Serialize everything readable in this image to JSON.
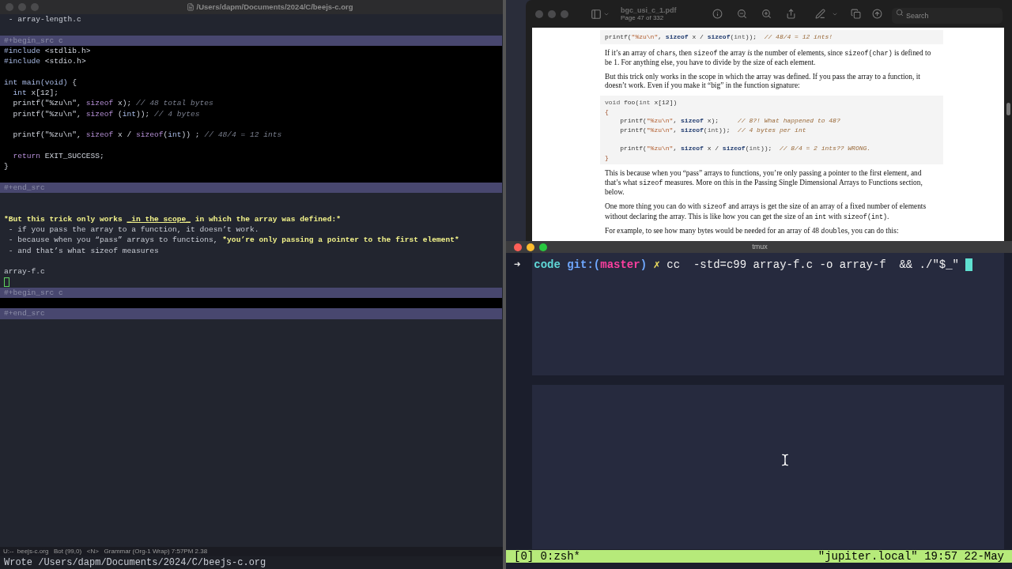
{
  "editor": {
    "title": "/Users/dapm/Documents/2024/C/beejs-c.org",
    "lines": [
      {
        "kind": "text",
        "segments": [
          {
            "kind": "plain",
            "text": " - array-length.c"
          }
        ]
      },
      {
        "kind": "blank"
      },
      {
        "kind": "block",
        "text": "#+begin_src c"
      },
      {
        "kind": "code",
        "tokens": [
          {
            "kind": "preproc",
            "text": "#include"
          },
          {
            "kind": "plain",
            "text": " <stdlib.h>"
          }
        ]
      },
      {
        "kind": "code",
        "tokens": [
          {
            "kind": "preproc",
            "text": "#include"
          },
          {
            "kind": "plain",
            "text": " <stdio.h>"
          }
        ]
      },
      {
        "kind": "code_blank"
      },
      {
        "kind": "code",
        "tokens": [
          {
            "kind": "type",
            "text": "int main(void)"
          },
          {
            "kind": "plain",
            "text": " {"
          }
        ]
      },
      {
        "kind": "code",
        "tokens": [
          {
            "kind": "type",
            "text": "  int"
          },
          {
            "kind": "plain",
            "text": " x[12];"
          }
        ]
      },
      {
        "kind": "code",
        "tokens": [
          {
            "kind": "plain",
            "text": "  printf(\"%zu\\n\", "
          },
          {
            "kind": "keyword",
            "text": "sizeof"
          },
          {
            "kind": "plain",
            "text": " x); "
          },
          {
            "kind": "comment",
            "text": "// 48 total bytes"
          }
        ]
      },
      {
        "kind": "code",
        "tokens": [
          {
            "kind": "plain",
            "text": "  printf(\"%zu\\n\", "
          },
          {
            "kind": "keyword",
            "text": "sizeof"
          },
          {
            "kind": "plain",
            "text": " ("
          },
          {
            "kind": "type",
            "text": "int"
          },
          {
            "kind": "plain",
            "text": ")); "
          },
          {
            "kind": "comment",
            "text": "// 4 bytes"
          }
        ]
      },
      {
        "kind": "code_blank"
      },
      {
        "kind": "code",
        "tokens": [
          {
            "kind": "plain",
            "text": "  printf(\"%zu\\n\", "
          },
          {
            "kind": "keyword",
            "text": "sizeof"
          },
          {
            "kind": "plain",
            "text": " x / "
          },
          {
            "kind": "keyword",
            "text": "sizeof"
          },
          {
            "kind": "plain",
            "text": "("
          },
          {
            "kind": "type",
            "text": "int"
          },
          {
            "kind": "plain",
            "text": ")) ; "
          },
          {
            "kind": "comment",
            "text": "// 48/4 = 12 ints"
          }
        ]
      },
      {
        "kind": "code_blank"
      },
      {
        "kind": "code",
        "tokens": [
          {
            "kind": "keyword",
            "text": "  return"
          },
          {
            "kind": "plain",
            "text": " EXIT_SUCCESS;"
          }
        ]
      },
      {
        "kind": "code",
        "tokens": [
          {
            "kind": "plain",
            "text": "}"
          }
        ]
      },
      {
        "kind": "code_blank"
      },
      {
        "kind": "block",
        "text": "#+end_src"
      },
      {
        "kind": "blank"
      },
      {
        "kind": "blank"
      },
      {
        "kind": "text",
        "segments": [
          {
            "kind": "bold",
            "text": "*But this trick only works "
          },
          {
            "kind": "bold_underline",
            "text": "_in the scope_"
          },
          {
            "kind": "bold",
            "text": " in which the array was defined:*"
          }
        ]
      },
      {
        "kind": "text",
        "segments": [
          {
            "kind": "plain",
            "text": " - if you pass the array to a function, it doesn’t work."
          }
        ]
      },
      {
        "kind": "text",
        "segments": [
          {
            "kind": "plain",
            "text": " - because when you “pass” arrays to functions, "
          },
          {
            "kind": "bold",
            "text": "*you’re only passing a pointer to the first element*"
          }
        ]
      },
      {
        "kind": "text",
        "segments": [
          {
            "kind": "plain",
            "text": " - and that’s what sizeof measures"
          }
        ]
      },
      {
        "kind": "blank"
      },
      {
        "kind": "text",
        "segments": [
          {
            "kind": "plain",
            "text": "array-f.c"
          }
        ]
      },
      {
        "kind": "cursor"
      },
      {
        "kind": "block",
        "text": "#+begin_src c"
      },
      {
        "kind": "code_blank"
      },
      {
        "kind": "block",
        "text": "#+end_src"
      }
    ],
    "modeline": "U:--  beejs-c.org   Bot (99,0)   <N>   Grammar (Org-1 Wrap) 7:57PM 2.38",
    "echo": "Wrote /Users/dapm/Documents/2024/C/beejs-c.org"
  },
  "pdf": {
    "file": "bgc_usi_c_1.pdf",
    "page": "Page 47 of 332",
    "search_placeholder": "Search",
    "blocks": [
      {
        "kind": "code",
        "lines": [
          {
            "kind": "tokens",
            "tokens": [
              {
                "kind": "plain",
                "text": "printf("
              },
              {
                "kind": "string",
                "text": "\"%zu\\n\""
              },
              {
                "kind": "plain",
                "text": ", "
              },
              {
                "kind": "keyword",
                "text": "sizeof"
              },
              {
                "kind": "plain",
                "text": " x / "
              },
              {
                "kind": "keyword",
                "text": "sizeof"
              },
              {
                "kind": "plain",
                "text": "("
              },
              {
                "kind": "type",
                "text": "int"
              },
              {
                "kind": "plain",
                "text": "));  "
              },
              {
                "kind": "comment",
                "text": "// 48/4 = 12 ints!"
              }
            ]
          }
        ]
      },
      {
        "kind": "para",
        "segments": [
          {
            "kind": "text",
            "text": "If it’s an array of "
          },
          {
            "kind": "code",
            "text": "char"
          },
          {
            "kind": "text",
            "text": "s, then "
          },
          {
            "kind": "code",
            "text": "sizeof"
          },
          {
            "kind": "text",
            "text": " the array "
          },
          {
            "kind": "italic",
            "text": "is"
          },
          {
            "kind": "text",
            "text": " the number of elements, since "
          },
          {
            "kind": "code",
            "text": "sizeof(char)"
          },
          {
            "kind": "text",
            "text": " is defined to be 1. For anything else, you have to divide by the size of each element."
          }
        ]
      },
      {
        "kind": "para",
        "segments": [
          {
            "kind": "text",
            "text": "But this trick only works in the scope in which the array was defined. If you pass the array to a function, it doesn’t work. Even if you make it “big” in the function signature:"
          }
        ]
      },
      {
        "kind": "code",
        "lines": [
          {
            "kind": "tokens",
            "tokens": [
              {
                "kind": "type",
                "text": "void"
              },
              {
                "kind": "plain",
                "text": " foo("
              },
              {
                "kind": "type",
                "text": "int"
              },
              {
                "kind": "plain",
                "text": " x[12])"
              }
            ]
          },
          {
            "kind": "tokens",
            "tokens": [
              {
                "kind": "punct",
                "text": "{"
              }
            ]
          },
          {
            "kind": "tokens",
            "tokens": [
              {
                "kind": "plain",
                "text": "    printf("
              },
              {
                "kind": "string",
                "text": "\"%zu\\n\""
              },
              {
                "kind": "plain",
                "text": ", "
              },
              {
                "kind": "keyword",
                "text": "sizeof"
              },
              {
                "kind": "plain",
                "text": " x);     "
              },
              {
                "kind": "comment",
                "text": "// 8?! What happened to 48?"
              }
            ]
          },
          {
            "kind": "tokens",
            "tokens": [
              {
                "kind": "plain",
                "text": "    printf("
              },
              {
                "kind": "string",
                "text": "\"%zu\\n\""
              },
              {
                "kind": "plain",
                "text": ", "
              },
              {
                "kind": "keyword",
                "text": "sizeof"
              },
              {
                "kind": "plain",
                "text": "("
              },
              {
                "kind": "type",
                "text": "int"
              },
              {
                "kind": "plain",
                "text": "));  "
              },
              {
                "kind": "comment",
                "text": "// 4 bytes per int"
              }
            ]
          },
          {
            "kind": "blank"
          },
          {
            "kind": "tokens",
            "tokens": [
              {
                "kind": "plain",
                "text": "    printf("
              },
              {
                "kind": "string",
                "text": "\"%zu\\n\""
              },
              {
                "kind": "plain",
                "text": ", "
              },
              {
                "kind": "keyword",
                "text": "sizeof"
              },
              {
                "kind": "plain",
                "text": " x / "
              },
              {
                "kind": "keyword",
                "text": "sizeof"
              },
              {
                "kind": "plain",
                "text": "("
              },
              {
                "kind": "type",
                "text": "int"
              },
              {
                "kind": "plain",
                "text": "));  "
              },
              {
                "kind": "comment",
                "text": "// 8/4 = 2 ints?? WRONG."
              }
            ]
          },
          {
            "kind": "tokens",
            "tokens": [
              {
                "kind": "punct",
                "text": "}"
              }
            ]
          }
        ]
      },
      {
        "kind": "para",
        "segments": [
          {
            "kind": "text",
            "text": "This is because when you “pass” arrays to functions, you’re only passing a pointer to the first element, and that’s what "
          },
          {
            "kind": "code",
            "text": "sizeof"
          },
          {
            "kind": "text",
            "text": " measures. More on this in the Passing Single Dimensional Arrays to Functions section, below."
          }
        ]
      },
      {
        "kind": "para",
        "segments": [
          {
            "kind": "text",
            "text": "One more thing you can do with "
          },
          {
            "kind": "code",
            "text": "sizeof"
          },
          {
            "kind": "text",
            "text": " and arrays is get the size of an array of a fixed number of elements without declaring the array. This is like how you can get the size of an "
          },
          {
            "kind": "code",
            "text": "int"
          },
          {
            "kind": "text",
            "text": " with "
          },
          {
            "kind": "code",
            "text": "sizeof(int)"
          },
          {
            "kind": "text",
            "text": "."
          }
        ]
      },
      {
        "kind": "para",
        "segments": [
          {
            "kind": "text",
            "text": "For example, to see how many bytes would be needed for an array of 48 "
          },
          {
            "kind": "code",
            "text": "double"
          },
          {
            "kind": "text",
            "text": "s, you can do this:"
          }
        ]
      }
    ]
  },
  "terminal": {
    "title": "tmux",
    "prompt": {
      "arrow": "➜",
      "dir": "code",
      "git_open": "git:(",
      "branch": "master",
      "git_close": ")",
      "dirty": "✗",
      "command": " cc  -std=c99 array-f.c -o array-f  && ./\"$_\""
    },
    "status": {
      "left": "[0] 0:zsh*",
      "right": "\"jupiter.local\" 19:57 22-May"
    }
  }
}
